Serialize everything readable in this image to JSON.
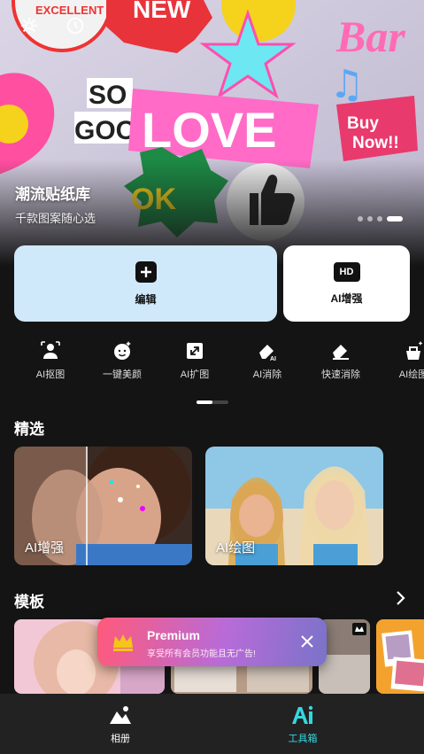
{
  "hero": {
    "title": "潮流贴纸库",
    "subtitle": "千款图案随心选",
    "sticker_texts": [
      "EXCELLENT",
      "NEW",
      "SO",
      "GOOD",
      "LOVE",
      "OK",
      "Bar",
      "Buy",
      "Now!!"
    ]
  },
  "actions": {
    "edit_label": "编辑",
    "enhance_label": "AI增强",
    "hd_badge": "HD"
  },
  "tools": [
    {
      "label": "AI抠图",
      "icon": "person-cutout-icon"
    },
    {
      "label": "一键美颜",
      "icon": "face-beauty-icon"
    },
    {
      "label": "AI扩图",
      "icon": "expand-icon"
    },
    {
      "label": "AI消除",
      "icon": "ai-eraser-icon"
    },
    {
      "label": "快速消除",
      "icon": "eraser-icon"
    },
    {
      "label": "AI绘图",
      "icon": "ai-draw-icon"
    }
  ],
  "featured": {
    "title": "精选",
    "items": [
      {
        "label": "AI增强"
      },
      {
        "label": "AI绘图"
      }
    ]
  },
  "templates": {
    "title": "模板"
  },
  "premium": {
    "title": "Premium",
    "subtitle": "享受所有会员功能且无广告!"
  },
  "nav": {
    "album_label": "相册",
    "toolbox_label": "工具箱",
    "active": "toolbox",
    "active_color": "#36d6e0"
  }
}
